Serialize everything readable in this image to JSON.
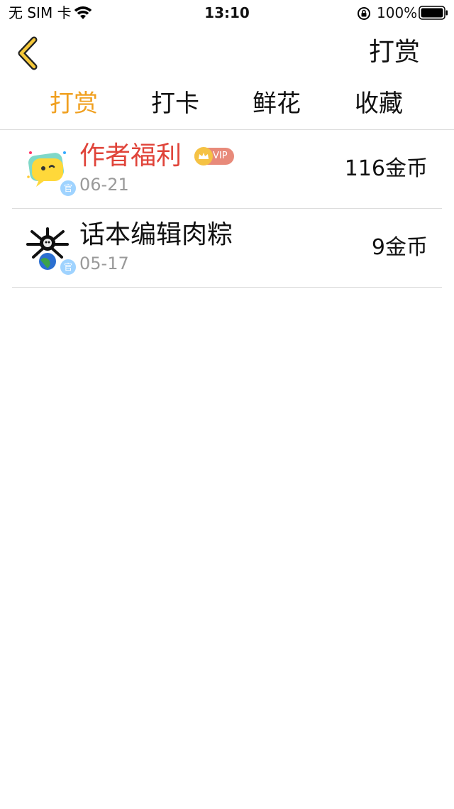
{
  "status_bar": {
    "carrier": "无 SIM 卡",
    "time": "13:10",
    "battery": "100%"
  },
  "nav": {
    "title": "打赏",
    "back_icon": "chevron-left-icon"
  },
  "tabs": [
    {
      "label": "打赏",
      "active": true
    },
    {
      "label": "打卡",
      "active": false
    },
    {
      "label": "鲜花",
      "active": false
    },
    {
      "label": "收藏",
      "active": false
    }
  ],
  "colors": {
    "accent": "#f0a020",
    "highlight_name": "#e0443a",
    "secondary_text": "#9a9a9a"
  },
  "items": [
    {
      "name": "作者福利",
      "vip_label": "VIP",
      "date": "06-21",
      "amount": "116金币",
      "badge": "官",
      "avatar_icon": "yellow-chat-bubble-avatar-icon"
    },
    {
      "name": "话本编辑肉粽",
      "date": "05-17",
      "amount": "9金币",
      "badge": "官",
      "avatar_icon": "globe-creature-avatar-icon"
    }
  ]
}
